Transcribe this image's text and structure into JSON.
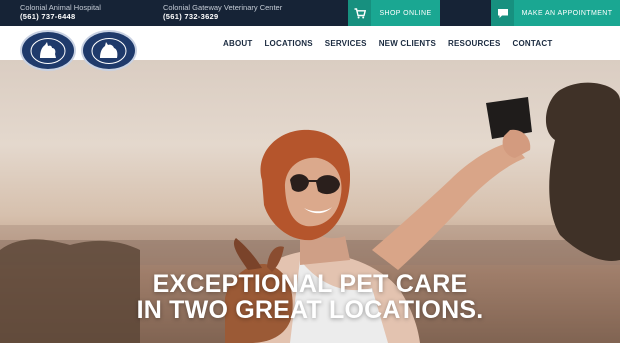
{
  "topbar": {
    "locations": [
      {
        "name": "Colonial Animal Hospital",
        "phone": "(561) 737-6448"
      },
      {
        "name": "Colonial Gateway Veterinary Center",
        "phone": "(561) 732-3629"
      }
    ],
    "shop_label": "SHOP ONLINE",
    "appointment_label": "MAKE AN APPOINTMENT",
    "icons": [
      "cart-icon",
      "chat-icon"
    ]
  },
  "header": {
    "logos": [
      "Colonial Animal Hospital logo",
      "Colonial Gateway Veterinary Center logo"
    ],
    "nav": [
      "ABOUT",
      "LOCATIONS",
      "SERVICES",
      "NEW CLIENTS",
      "RESOURCES",
      "CONTACT"
    ]
  },
  "hero": {
    "headline_line1": "EXCEPTIONAL PET CARE",
    "headline_line2": "IN TWO GREAT LOCATIONS."
  },
  "colors": {
    "topbar_bg": "#162336",
    "accent_teal": "#1aa792",
    "nav_text": "#1b2b40",
    "logo_navy": "#1f3a6b"
  }
}
